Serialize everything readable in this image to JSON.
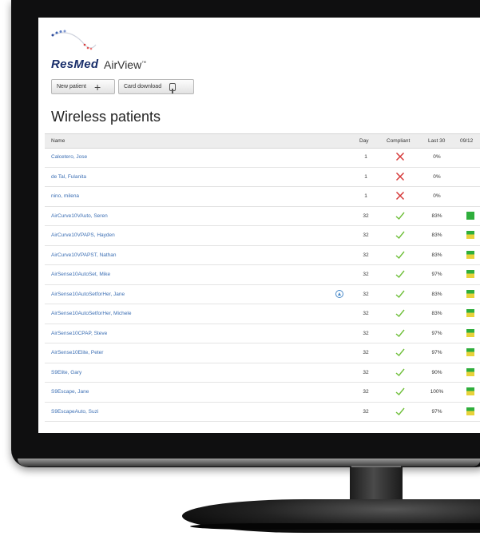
{
  "app": {
    "brand": "ResMed",
    "product": "AirView",
    "trademark": "™"
  },
  "toolbar": {
    "new_patient_label": "New patient",
    "card_download_label": "Card download"
  },
  "page": {
    "title": "Wireless patients"
  },
  "table": {
    "columns": [
      "Name",
      "Day",
      "Compliant",
      "Last 30",
      "09/12"
    ],
    "rows": [
      {
        "name": "Calcetero, Jose",
        "day": "1",
        "compliant": "no",
        "last30": "0%",
        "status": null,
        "alert": false
      },
      {
        "name": "de Tal, Fulanita",
        "day": "1",
        "compliant": "no",
        "last30": "0%",
        "status": null,
        "alert": false
      },
      {
        "name": "nino, milena",
        "day": "1",
        "compliant": "no",
        "last30": "0%",
        "status": null,
        "alert": false
      },
      {
        "name": "AirCurve10VAuto, Seren",
        "day": "32",
        "compliant": "yes",
        "last30": "83%",
        "status": "green",
        "alert": false
      },
      {
        "name": "AirCurve10VPAPS, Hayden",
        "day": "32",
        "compliant": "yes",
        "last30": "83%",
        "status": "mixed",
        "alert": false
      },
      {
        "name": "AirCurve10VPAPST, Nathan",
        "day": "32",
        "compliant": "yes",
        "last30": "83%",
        "status": "mixed",
        "alert": false
      },
      {
        "name": "AirSense10AutoSet, Mike",
        "day": "32",
        "compliant": "yes",
        "last30": "97%",
        "status": "mixed",
        "alert": false
      },
      {
        "name": "AirSense10AutoSetforHer, Jane",
        "day": "32",
        "compliant": "yes",
        "last30": "83%",
        "status": "mixed",
        "alert": true
      },
      {
        "name": "AirSense10AutoSetforHer, Michele",
        "day": "32",
        "compliant": "yes",
        "last30": "83%",
        "status": "mixed",
        "alert": false
      },
      {
        "name": "AirSense10CPAP, Steve",
        "day": "32",
        "compliant": "yes",
        "last30": "97%",
        "status": "mixed",
        "alert": false
      },
      {
        "name": "AirSense10Elite, Peter",
        "day": "32",
        "compliant": "yes",
        "last30": "97%",
        "status": "mixed",
        "alert": false
      },
      {
        "name": "S9Elite, Gary",
        "day": "32",
        "compliant": "yes",
        "last30": "90%",
        "status": "mixed",
        "alert": false
      },
      {
        "name": "S9Escape, Jane",
        "day": "32",
        "compliant": "yes",
        "last30": "100%",
        "status": "mixed",
        "alert": false
      },
      {
        "name": "S9EscapeAuto, Suzi",
        "day": "32",
        "compliant": "yes",
        "last30": "97%",
        "status": "mixed",
        "alert": false
      }
    ]
  },
  "colors": {
    "brand_navy": "#1a2f6b",
    "link_blue": "#3c6fb4",
    "check_green": "#6fbf3a",
    "cross_red": "#d63a3a",
    "status_green": "#2fae3c",
    "status_yellow": "#e8d23a"
  },
  "icons": {
    "compliant_yes": "checkmark-icon",
    "compliant_no": "x-icon",
    "new_patient": "plus-icon",
    "card_download": "card-icon",
    "alert": "alert-triangle-icon"
  }
}
